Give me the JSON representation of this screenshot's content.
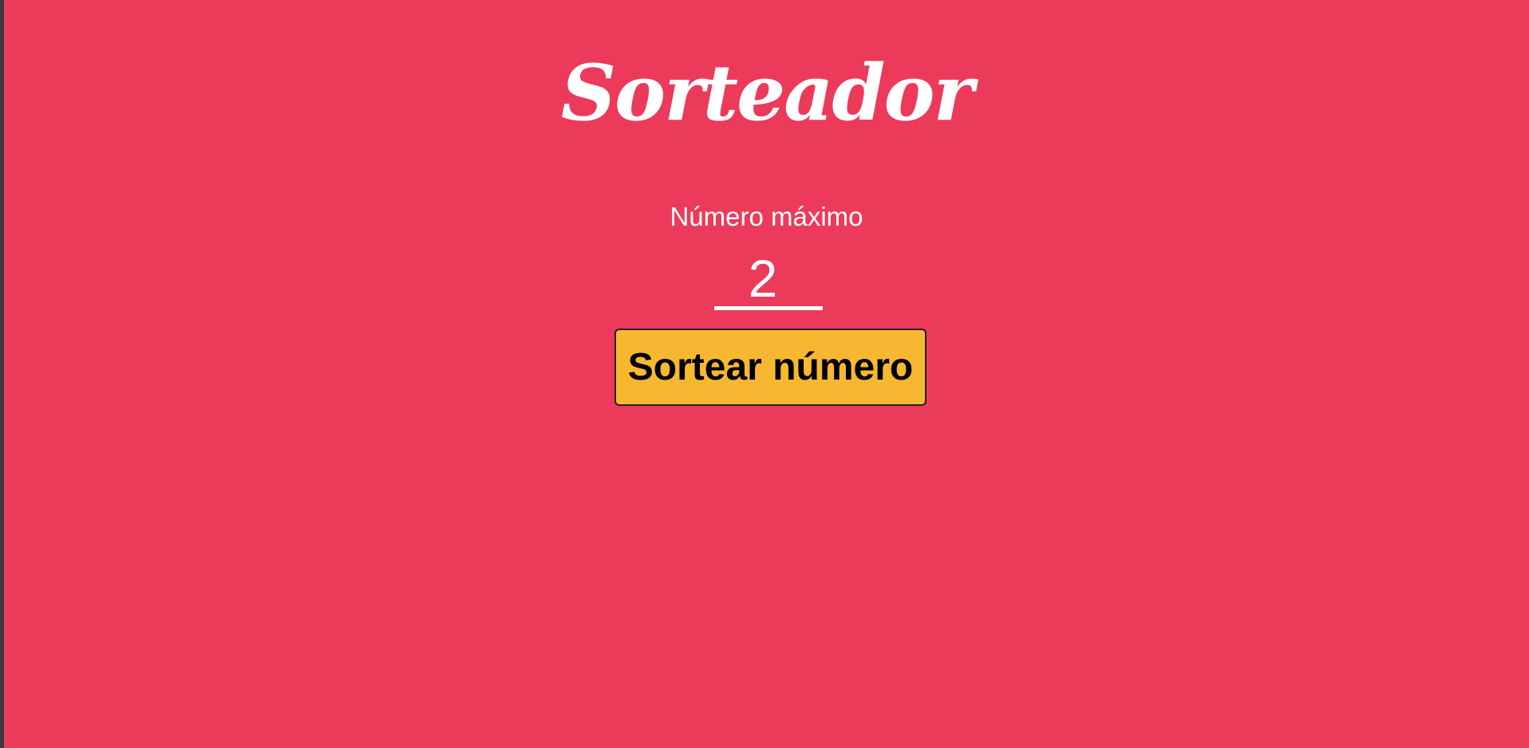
{
  "page": {
    "title": "Sorteador",
    "background_color": "#EC3A5B",
    "accent_color": "#F7B731"
  },
  "form": {
    "max_label": "Número máximo",
    "max_value": "2",
    "draw_button_label": "Sortear número"
  }
}
